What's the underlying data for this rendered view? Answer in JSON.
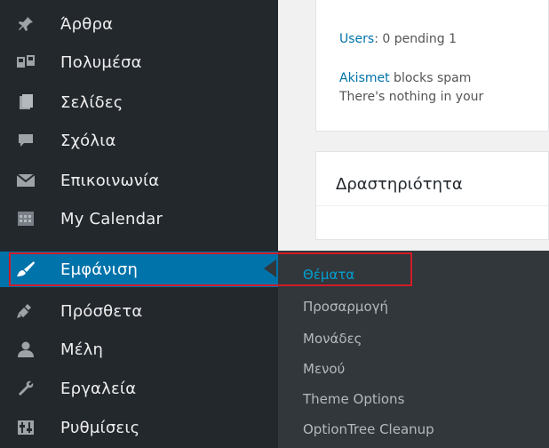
{
  "menu": {
    "items": [
      {
        "label": "Άρθρα",
        "icon": "pushpin-icon"
      },
      {
        "label": "Πολυμέσα",
        "icon": "media-icon"
      },
      {
        "label": "Σελίδες",
        "icon": "page-icon"
      },
      {
        "label": "Σχόλια",
        "icon": "comment-icon"
      },
      {
        "label": "Επικοινωνία",
        "icon": "envelope-icon"
      },
      {
        "label": "My Calendar",
        "icon": "calendar-icon"
      },
      {
        "label": "Εμφάνιση",
        "icon": "paintbrush-icon",
        "active": true
      },
      {
        "label": "Πρόσθετα",
        "icon": "plugin-icon"
      },
      {
        "label": "Μέλη",
        "icon": "user-icon"
      },
      {
        "label": "Εργαλεία",
        "icon": "wrench-icon"
      },
      {
        "label": "Ρυθμίσεις",
        "icon": "settings-icon"
      }
    ]
  },
  "submenu": {
    "items": [
      {
        "label": "Θέματα",
        "current": true
      },
      {
        "label": "Προσαρμογή"
      },
      {
        "label": "Μονάδες"
      },
      {
        "label": "Μενού"
      },
      {
        "label": "Theme Options"
      },
      {
        "label": "OptionTree Cleanup"
      }
    ]
  },
  "main": {
    "users_link": "Users",
    "users_text": ": 0 pending   1",
    "akismet_link": "Akismet",
    "akismet_text": " blocks spam",
    "nothing_text": "There's nothing in your",
    "activity_title": "Δραστηριότητα"
  },
  "colors": {
    "sidebar_bg": "#23282d",
    "active_bg": "#0073aa",
    "submenu_bg": "#32373c",
    "submenu_current": "#00a0d2",
    "highlight_border": "#d01c26",
    "link": "#0073aa"
  }
}
